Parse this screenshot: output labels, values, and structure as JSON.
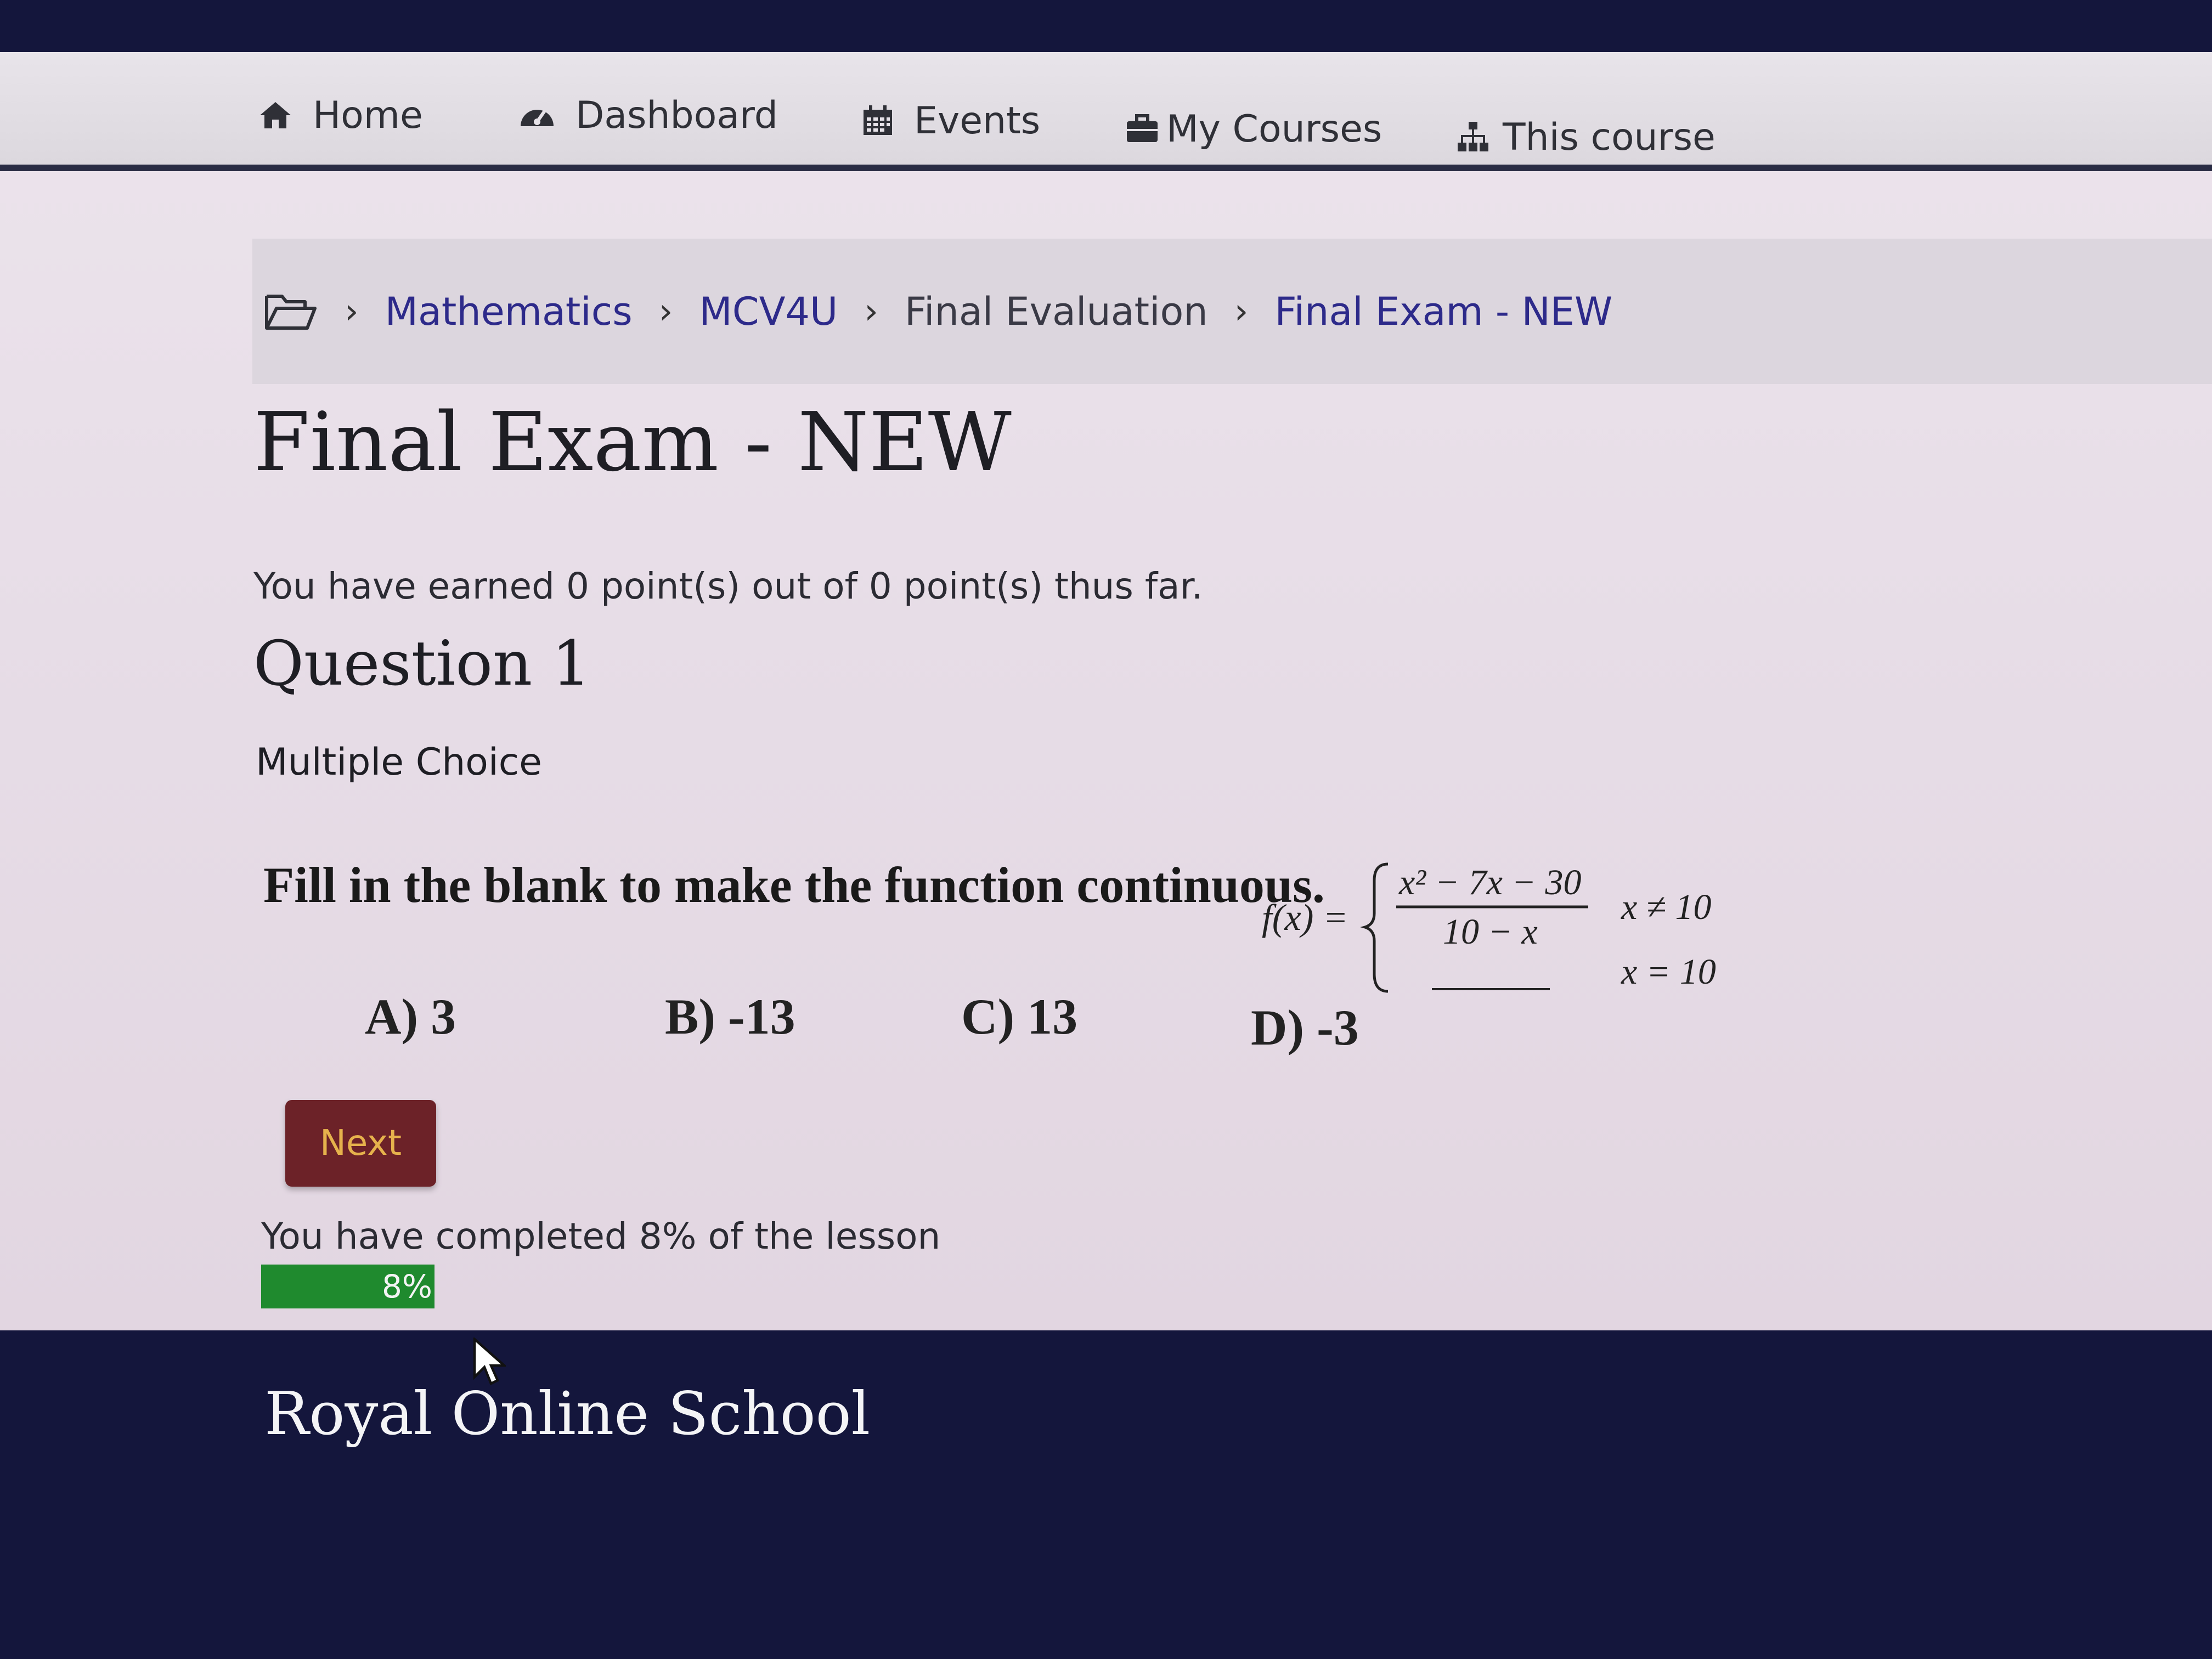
{
  "nav": {
    "items": [
      {
        "label": "Home",
        "icon": "home-icon"
      },
      {
        "label": "Dashboard",
        "icon": "dashboard-icon"
      },
      {
        "label": "Events",
        "icon": "calendar-icon"
      },
      {
        "label": "My Courses",
        "icon": "briefcase-icon"
      },
      {
        "label": "This course",
        "icon": "sitemap-icon"
      }
    ]
  },
  "breadcrumb": {
    "icon": "folder-icon",
    "items": [
      "Mathematics",
      "MCV4U",
      "Final Evaluation",
      "Final Exam - NEW"
    ]
  },
  "page": {
    "title": "Final Exam - NEW",
    "points": "You have earned 0 point(s) out of 0 point(s) thus far."
  },
  "question": {
    "title": "Question 1",
    "type": "Multiple Choice",
    "text": "Fill in the blank to make the function continuous.",
    "formula": {
      "lhs": "f(x) =",
      "numerator": "x² − 7x − 30",
      "denominator": "10 − x",
      "cond1": "x ≠ 10",
      "cond2": "x = 10"
    },
    "choices": [
      "A) 3",
      "B)  -13",
      "C)  13",
      "D) -3"
    ]
  },
  "buttons": {
    "next": "Next"
  },
  "progress": {
    "label": "You have completed 8% of the lesson",
    "percent": 8,
    "text": "8%",
    "fill_color": "#1f8a2e"
  },
  "footer": {
    "title": "Royal Online School"
  },
  "colors": {
    "link": "#2d2a8a",
    "button_bg": "#6c2228",
    "button_text": "#e6b24c",
    "footer_bg": "#14163c"
  }
}
